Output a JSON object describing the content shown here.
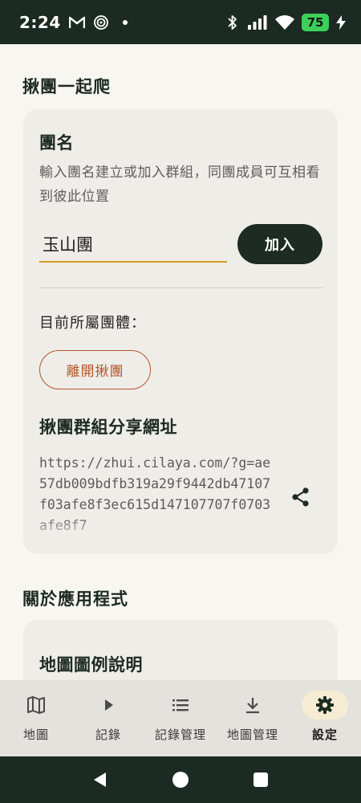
{
  "status_bar": {
    "time": "2:24",
    "battery_level": "75",
    "icons": [
      "gmail-icon",
      "radar-icon",
      "dot-icon",
      "bluetooth-icon",
      "signal-icon",
      "wifi-icon",
      "battery-icon",
      "charging-icon"
    ]
  },
  "team_section": {
    "title": "揪團一起爬",
    "team_name_title": "團名",
    "team_name_desc": "輸入團名建立或加入群組，同團成員可互相看到彼此位置",
    "team_name_value": "玉山團",
    "join_label": "加入",
    "current_group_label": "目前所屬團體：",
    "leave_label": "離開揪團",
    "share_title": "揪團群組分享網址",
    "share_url": "https://zhui.cilaya.com/?g=ae57db009bdfb319a29f9442db47107f03afe8f3ec615d147107707f0703afe8f7"
  },
  "about_section": {
    "title": "關於應用程式",
    "legend_title": "地圖圖例說明"
  },
  "bottom_nav": {
    "items": [
      {
        "label": "地圖",
        "icon": "map-icon"
      },
      {
        "label": "記錄",
        "icon": "play-icon"
      },
      {
        "label": "記錄管理",
        "icon": "list-icon"
      },
      {
        "label": "地圖管理",
        "icon": "download-icon"
      },
      {
        "label": "設定",
        "icon": "gear-icon",
        "active": true
      }
    ]
  },
  "colors": {
    "accent_dark": "#1d2b22",
    "input_underline": "#d79b24",
    "leave_button": "#b3552b",
    "active_nav_bg": "#f6ecd3"
  }
}
